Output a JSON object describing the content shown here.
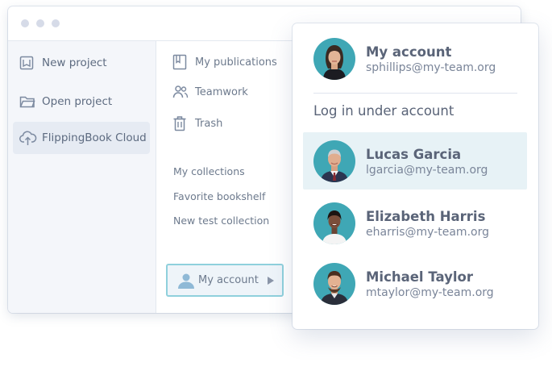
{
  "sidebar": {
    "items": [
      {
        "label": "New project",
        "icon": "new-project-icon"
      },
      {
        "label": "Open project",
        "icon": "folder-icon"
      },
      {
        "label": "FlippingBook Cloud",
        "icon": "cloud-upload-icon",
        "active": true
      }
    ]
  },
  "content": {
    "nav": [
      {
        "label": "My publications",
        "icon": "publications-icon"
      },
      {
        "label": "Teamwork",
        "icon": "people-icon"
      },
      {
        "label": "Trash",
        "icon": "trash-icon"
      }
    ],
    "collections": [
      "My collections",
      "Favorite bookshelf",
      "New test collection"
    ],
    "my_account_button": {
      "label": "My account",
      "icon": "user-icon",
      "arrow": "play-right-icon"
    }
  },
  "popup": {
    "current": {
      "name": "My account",
      "email": "sphillips@my-team.org"
    },
    "login_under_heading": "Log in under account",
    "accounts": [
      {
        "name": "Lucas Garcia",
        "email": "lgarcia@my-team.org",
        "highlighted": true
      },
      {
        "name": "Elizabeth Harris",
        "email": "eharris@my-team.org"
      },
      {
        "name": "Michael Taylor",
        "email": "mtaylor@my-team.org"
      }
    ]
  },
  "colors": {
    "accent": "#8fd0dc",
    "highlight": "#e7f2f6",
    "text": "#5a6478",
    "sidebar_bg": "#f4f6fa"
  }
}
